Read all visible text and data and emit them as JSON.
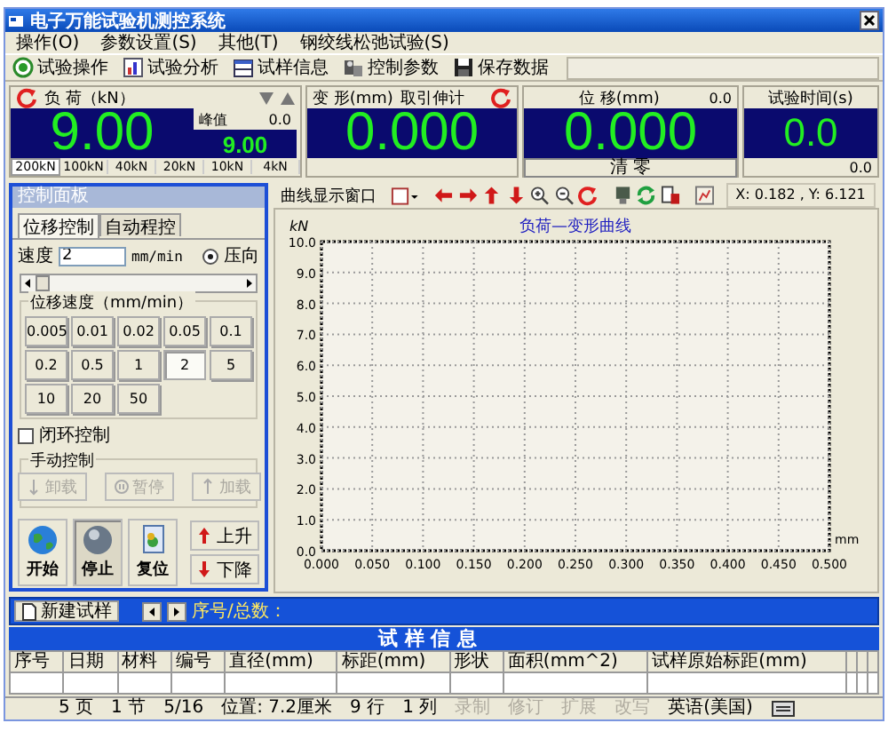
{
  "window": {
    "title": "电子万能试验机测控系统"
  },
  "menu": [
    "操作(O)",
    "参数设置(S)",
    "其他(T)",
    "钢绞线松弛试验(S)"
  ],
  "toolbar": [
    {
      "label": "试验操作",
      "kind": "run"
    },
    {
      "label": "试验分析",
      "kind": "analysis"
    },
    {
      "label": "试样信息",
      "kind": "info"
    },
    {
      "label": "控制参数",
      "kind": "params"
    },
    {
      "label": "保存数据",
      "kind": "save"
    }
  ],
  "load": {
    "label": "负 荷（kN）",
    "peak_label": "峰值",
    "peak": "0.0",
    "value": "9.00",
    "peak_value": "9.00",
    "ranges": [
      {
        "label": "200kN",
        "selected": true
      },
      {
        "label": "100kN",
        "selected": false
      },
      {
        "label": "40kN",
        "selected": false
      },
      {
        "label": "20kN",
        "selected": false
      },
      {
        "label": "10kN",
        "selected": false
      },
      {
        "label": "4kN",
        "selected": false
      }
    ]
  },
  "deformation": {
    "label": "变 形(mm)",
    "extensometer": "取引伸计",
    "value": "0.000"
  },
  "displacement": {
    "label": "位 移(mm)",
    "reading": "0.0",
    "value": "0.000",
    "button": "清 零"
  },
  "test_time": {
    "label": "试验时间(s)",
    "value": "0.0",
    "reading": "0.0"
  },
  "control_panel": {
    "title": "控制面板",
    "tabs": [
      {
        "label": "位移控制",
        "selected": true
      },
      {
        "label": "自动程控",
        "selected": false
      }
    ],
    "speed_label": "速度",
    "speed_value": "2",
    "speed_unit": "mm/min",
    "direction": {
      "label": "压向",
      "checked": true
    },
    "speed_slider": {
      "level": 0
    },
    "speed_group": "位移速度（mm/min）",
    "speed_buttons": [
      {
        "label": "0.005",
        "selected": false
      },
      {
        "label": "0.01",
        "selected": false
      },
      {
        "label": "0.02",
        "selected": false
      },
      {
        "label": "0.05",
        "selected": false
      },
      {
        "label": "0.1",
        "selected": false
      },
      {
        "label": "0.2",
        "selected": false
      },
      {
        "label": "0.5",
        "selected": false
      },
      {
        "label": "1",
        "selected": false
      },
      {
        "label": "2",
        "selected": true
      },
      {
        "label": "5",
        "selected": false
      },
      {
        "label": "10",
        "selected": false
      },
      {
        "label": "20",
        "selected": false
      },
      {
        "label": "50",
        "selected": false
      }
    ],
    "closed_loop": {
      "label": "闭环控制",
      "checked": false
    },
    "manual": {
      "title": "手动控制",
      "buttons": [
        {
          "label": "卸载",
          "kind": "unload",
          "disabled": true
        },
        {
          "label": "暂停",
          "kind": "pause",
          "disabled": true
        },
        {
          "label": "加载",
          "kind": "load",
          "disabled": true
        }
      ]
    },
    "actions": [
      {
        "label": "开始",
        "kind": "start",
        "selected": false
      },
      {
        "label": "停止",
        "kind": "stop",
        "selected": true
      },
      {
        "label": "复位",
        "kind": "reset",
        "selected": false
      }
    ],
    "jog": [
      {
        "label": "上升",
        "kind": "up"
      },
      {
        "label": "下降",
        "kind": "down"
      }
    ]
  },
  "chart_panel": {
    "window_label": "曲线显示窗口",
    "coords": "X: 0.182 , Y: 6.121",
    "chart_data": {
      "type": "line",
      "grid": true,
      "title": "负荷—变形曲线",
      "xlabel": "mm",
      "ylabel": "kN",
      "xlim": [
        0,
        0.5
      ],
      "ylim": [
        0,
        10
      ],
      "xticks": [
        {
          "value": 0,
          "label": "0.000"
        },
        {
          "value": 0.05,
          "label": "0.050"
        },
        {
          "value": 0.1,
          "label": "0.100"
        },
        {
          "value": 0.15,
          "label": "0.150"
        },
        {
          "value": 0.2,
          "label": "0.200"
        },
        {
          "value": 0.25,
          "label": "0.250"
        },
        {
          "value": 0.3,
          "label": "0.300"
        },
        {
          "value": 0.35,
          "label": "0.350"
        },
        {
          "value": 0.4,
          "label": "0.400"
        },
        {
          "value": 0.45,
          "label": "0.450"
        },
        {
          "value": 0.5,
          "label": "0.500"
        }
      ],
      "yticks": [
        {
          "value": 0,
          "label": "0.0"
        },
        {
          "value": 1,
          "label": "1.0"
        },
        {
          "value": 2,
          "label": "2.0"
        },
        {
          "value": 3,
          "label": "3.0"
        },
        {
          "value": 4,
          "label": "4.0"
        },
        {
          "value": 5,
          "label": "5.0"
        },
        {
          "value": 6,
          "label": "6.0"
        },
        {
          "value": 7,
          "label": "7.0"
        },
        {
          "value": 8,
          "label": "8.0"
        },
        {
          "value": 9,
          "label": "9.0"
        },
        {
          "value": 10,
          "label": "10.0"
        }
      ]
    }
  },
  "specimens": {
    "new_button": "新建试样",
    "position_label": "序号/总数：",
    "title": "试 样 信 息",
    "columns": [
      "序号",
      "日期",
      "材料",
      "编号",
      "直径(mm)",
      "标距(mm)",
      "形状",
      "面积(mm^2)",
      "试样原始标距(mm)"
    ]
  },
  "status_bar": [
    {
      "text": "5 页",
      "disabled": false
    },
    {
      "text": "1 节",
      "disabled": false
    },
    {
      "text": "5/16",
      "disabled": false
    },
    {
      "text": "位置: 7.2厘米",
      "disabled": false
    },
    {
      "text": "9 行",
      "disabled": false
    },
    {
      "text": "1 列",
      "disabled": false
    },
    {
      "text": "录制",
      "disabled": true
    },
    {
      "text": "修订",
      "disabled": true
    },
    {
      "text": "扩展",
      "disabled": true
    },
    {
      "text": "改写",
      "disabled": true
    },
    {
      "text": "英语(美国)",
      "disabled": false
    }
  ]
}
